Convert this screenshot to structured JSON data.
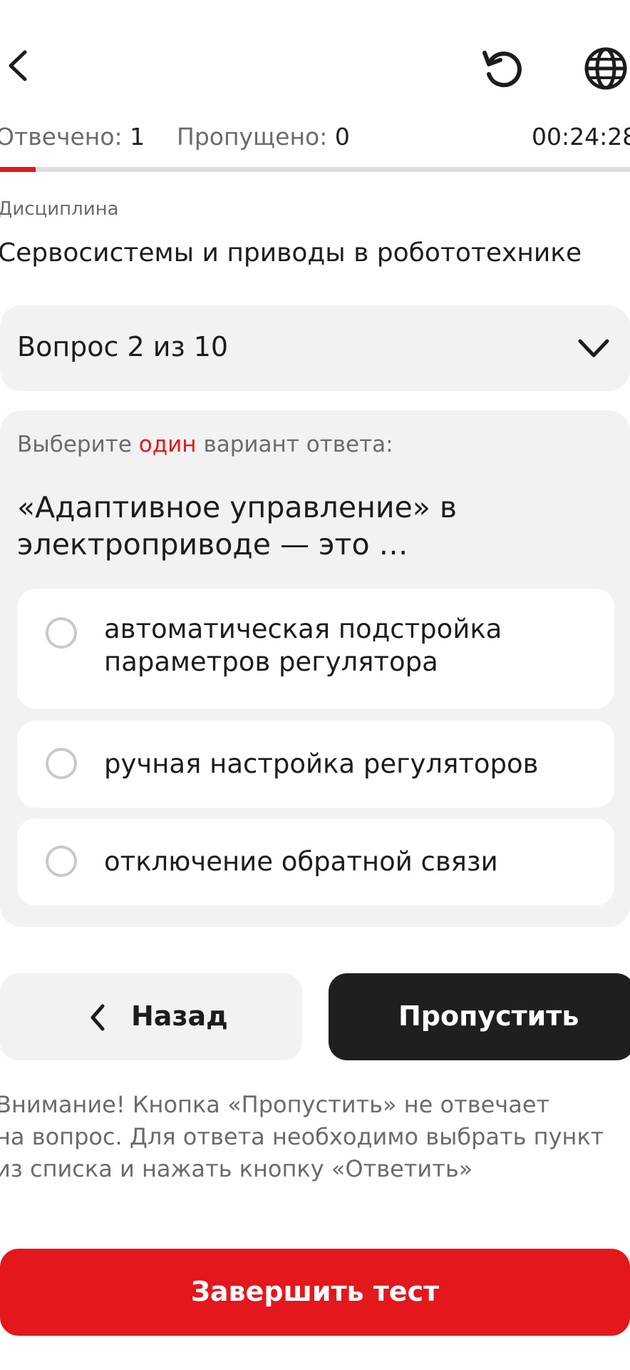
{
  "header": {
    "back_icon": "chevron-left-icon",
    "reset_icon": "restart-icon",
    "language_icon": "globe-icon"
  },
  "stats": {
    "answered_label": "Отвечено:",
    "answered_value": "1",
    "skipped_label": "Пропущено:",
    "skipped_value": "0",
    "timer": "00:24:28"
  },
  "progress": {
    "fraction": 0.056,
    "fill_color": "#e3171c",
    "track_color": "#dedede"
  },
  "discipline": {
    "label": "Дисциплина",
    "title": "Сервосистемы и приводы в робототехнике"
  },
  "question_select": {
    "label": "Вопрос 2 из 10",
    "icon": "chevron-down-icon"
  },
  "question": {
    "instruction_before": "Выберите",
    "instruction_accent": "один",
    "instruction_after": "вариант ответа:",
    "text": "«Адаптивное управление» в электроприводе — это …",
    "options": [
      {
        "label": "автоматическая подстройка параметров регулятора"
      },
      {
        "label": "ручная настройка регуляторов"
      },
      {
        "label": "отключение обратной связи"
      }
    ]
  },
  "actions": {
    "back_label": "Назад",
    "skip_label": "Пропустить",
    "finish_label": "Завершить тест"
  },
  "warning": {
    "line1": "Внимание! Кнопка «Пропустить» не отвечает",
    "line2": "на вопрос. Для ответа необходимо выбрать пункт",
    "line3": "из списка и нажать кнопку «Ответить»"
  },
  "colors": {
    "accent": "#e3171c",
    "dark_button": "#1f1f1f",
    "card_bg": "#f2f2f2"
  }
}
